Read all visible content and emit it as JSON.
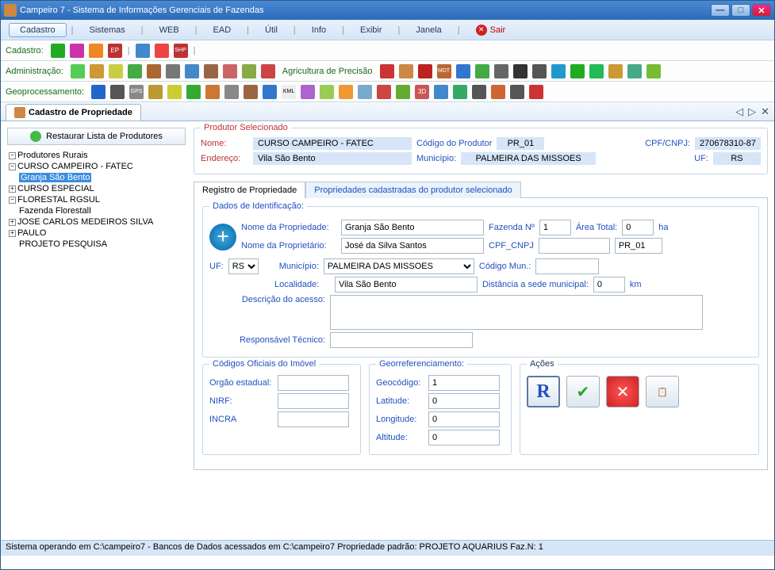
{
  "title": "Campeiro 7 - Sistema de Informações Gerenciais de Fazendas",
  "menu": {
    "cadastro": "Cadastro",
    "sistemas": "Sistemas",
    "web": "WEB",
    "ead": "EAD",
    "util": "Útil",
    "info": "Info",
    "exibir": "Exibir",
    "janela": "Janela",
    "sair": "Sair"
  },
  "toolbars": {
    "cadastro": "Cadastro:",
    "administracao": "Administração:",
    "agprecisao": "Agricultura de Precisão",
    "geo": "Geoprocessamento:"
  },
  "tab": "Cadastro de Propriedade",
  "restore": "Restaurar Lista de Produtores",
  "tree": {
    "root": "Produtores Rurais",
    "n1": "CURSO CAMPEIRO - FATEC",
    "n1a": "Granja São Bento",
    "n2": "CURSO ESPECIAL",
    "n3": "FLORESTAL RGSUL",
    "n3a": "Fazenda FlorestalI",
    "n4": "JOSE CARLOS MEDEIROS SILVA",
    "n5": "PAULO",
    "n6": "PROJETO PESQUISA"
  },
  "produtor": {
    "legend": "Produtor Selecionado",
    "nome_l": "Nome:",
    "nome": "CURSO CAMPEIRO - FATEC",
    "cod_l": "Código do Produtor",
    "cod": "PR_01",
    "cpf_l": "CPF/CNPJ:",
    "cpf": "270678310-87",
    "end_l": "Endereço:",
    "end": "Vila São Bento",
    "mun_l": "Município:",
    "mun": "PALMEIRA DAS MISSOES",
    "uf_l": "UF:",
    "uf": "RS"
  },
  "tabsForm": {
    "t1": "Registro de Propriedade",
    "t2": "Propriedades cadastradas do produtor selecionado"
  },
  "ident": {
    "legend": "Dados de Identificação:",
    "nome_prop_l": "Nome da Propriedade:",
    "nome_prop": "Granja São Bento",
    "faz_l": "Fazenda Nº",
    "faz": "1",
    "area_l": "Área Total:",
    "area": "0",
    "ha": "ha",
    "nome_propri_l": "Nome da Proprietário:",
    "nome_propri": "José da Silva Santos",
    "cpf_l": "CPF_CNPJ",
    "cpf": "",
    "code": "PR_01",
    "uf_l": "UF:",
    "uf": "RS",
    "mun_l": "Município:",
    "mun": "PALMEIRA DAS MISSOES",
    "codmun_l": "Código Mun.:",
    "codmun": "",
    "loc_l": "Localidade:",
    "loc": "Vila São Bento",
    "dist_l": "Distância a sede municipal:",
    "dist": "0",
    "km": "km",
    "desc_l": "Descrição do acesso:",
    "desc": "",
    "resp_l": "Responsável Técnico:",
    "resp": ""
  },
  "codigos": {
    "legend": "Códigos Oficiais do Imóvel",
    "orgao_l": "Orgão estadual:",
    "orgao": "",
    "nirf_l": "NIRF:",
    "nirf": "",
    "incra_l": "INCRA",
    "incra": ""
  },
  "geo": {
    "legend": "Georreferenciamento:",
    "geoc_l": "Geocódigo:",
    "geoc": "1",
    "lat_l": "Latitude:",
    "lat": "0",
    "lon_l": "Longitude:",
    "lon": "0",
    "alt_l": "Altitude:",
    "alt": "0"
  },
  "acoes": {
    "legend": "Ações",
    "r": "R"
  },
  "status": "Sistema operando em C:\\campeiro7   -  Bancos de Dados acessados em C:\\campeiro7  Propriedade padrão: PROJETO AQUARIUS Faz.N:  1"
}
